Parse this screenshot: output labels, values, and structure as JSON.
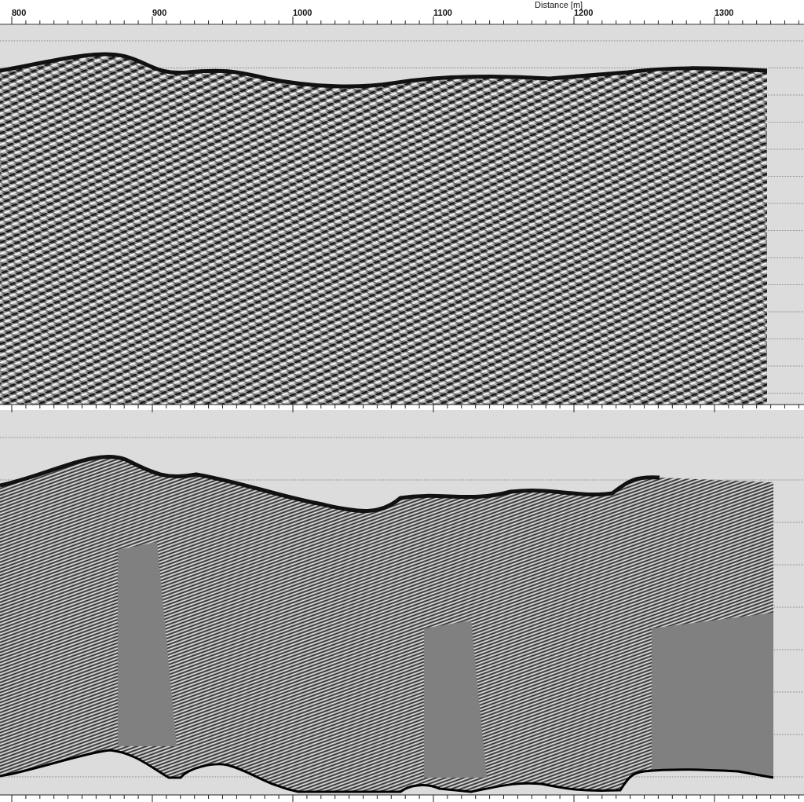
{
  "axis": {
    "title": "Distance [m]",
    "ticks": [
      "800",
      "900",
      "1000",
      "1100",
      "1200",
      "1300"
    ]
  }
}
